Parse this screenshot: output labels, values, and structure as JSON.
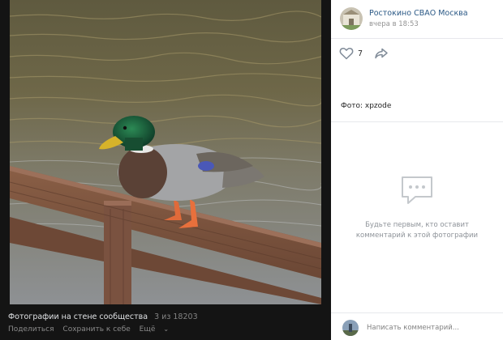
{
  "viewer": {
    "album_title": "Фотографии на стене сообщества",
    "counter": "3 из 18203",
    "actions": {
      "share": "Поделиться",
      "save": "Сохранить к себе",
      "more": "Ещё"
    }
  },
  "post": {
    "community_name": "Ростокино СВАО Москва",
    "time": "вчера в 18:53",
    "likes": "7",
    "caption": "Фото: xpzode"
  },
  "comments": {
    "empty_line1": "Будьте первым, кто оставит",
    "empty_line2": "комментарий к этой фотографии",
    "placeholder": "Написать комментарий..."
  },
  "colors": {
    "viewer_bg": "#141414",
    "link": "#2a5885",
    "muted": "#939393"
  },
  "icons": [
    "heart-icon",
    "share-arrow-icon",
    "comments-empty-icon",
    "chevron-down-icon"
  ]
}
